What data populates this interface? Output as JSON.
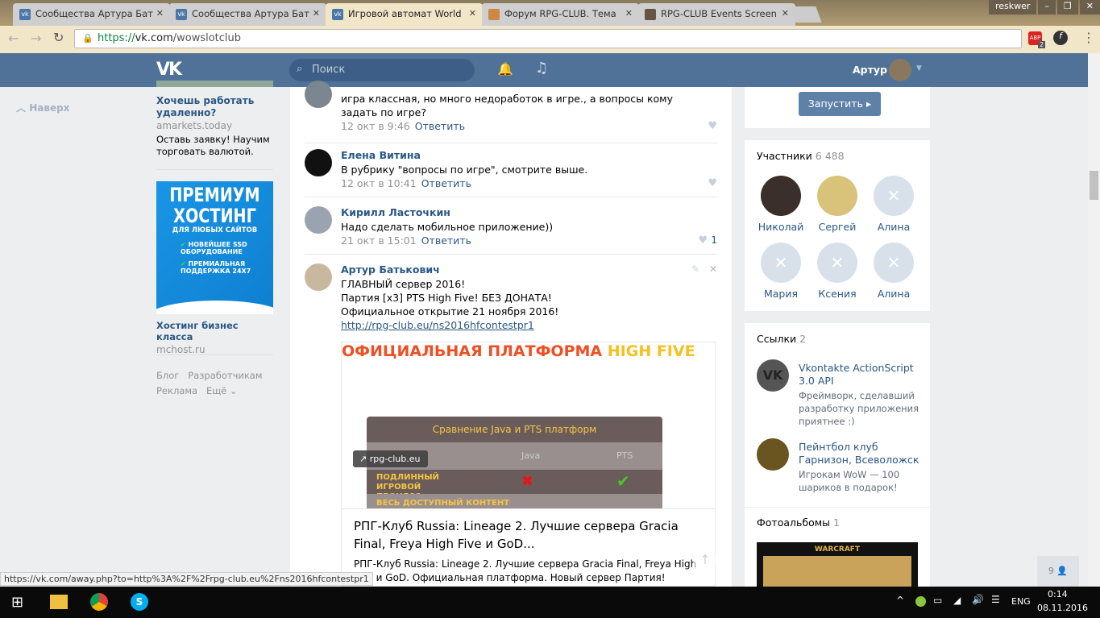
{
  "browser": {
    "tabs": [
      {
        "title": "Сообщества Артура Бат"
      },
      {
        "title": "Сообщества Артура Бат"
      },
      {
        "title": "Игровой автомат World"
      },
      {
        "title": "Форум RPG-CLUB. Тема"
      },
      {
        "title": "RPG-CLUB Events Screen"
      }
    ],
    "user": "reskwer",
    "url_scheme": "https://",
    "url_host": "vk.com",
    "url_path": "/wowslotclub",
    "abp_count": "2",
    "status_url": "https://vk.com/away.php?to=http%3A%2F%2Frpg-club.eu%2Fns2016hfcontestpr1"
  },
  "header": {
    "search_placeholder": "Поиск",
    "user_name": "Артур"
  },
  "left": {
    "to_top": "Наверх"
  },
  "ads": [
    {
      "title": "Хочешь работать удаленно?",
      "domain": "amarkets.today",
      "text": "Оставь заявку! Научим торговать валютой."
    },
    {
      "banner_l1": "ПРЕМИУМ",
      "banner_l2": "ХОСТИНГ",
      "banner_l3": "ДЛЯ ЛЮБЫХ САЙТОВ",
      "banner_f1": "НОВЕЙШЕЕ SSD ОБОРУДОВАНИЕ",
      "banner_f2": "ПРЕМИАЛЬНАЯ ПОДДЕРЖКА 24X7",
      "title": "Хостинг бизнес класса",
      "domain": "mchost.ru"
    }
  ],
  "footer_links": [
    "Блог",
    "Разработчикам",
    "Реклама",
    "Ещё"
  ],
  "comments": [
    {
      "text": "игра классная, но много недоработок в игре., а вопросы кому задать по игре?",
      "time": "12 окт в 9:46",
      "reply": "Ответить"
    },
    {
      "name": "Елена Витина",
      "text": "В рубрику \"вопросы по игре\", смотрите выше.",
      "time": "12 окт в 10:41",
      "reply": "Ответить"
    },
    {
      "name": "Кирилл Ласточкин",
      "text": "Надо сделать мобильное приложение))",
      "time": "21 окт в 15:01",
      "reply": "Ответить",
      "likes": "1"
    },
    {
      "name": "Артур Батькович",
      "line1": "ГЛАВНЫЙ сервер 2016!",
      "line2": "Партия [x3] PTS High Five! БЕЗ ДОНАТА!",
      "line3": "Официальное открытие 21 ноября 2016!",
      "link": "http://rpg-club.eu/ns2016hfcontestpr1"
    }
  ],
  "attachment": {
    "banner_red": "ОФИЦИАЛЬНАЯ ПЛАТФОРМА ",
    "banner_yellow": "HIGH FIVE",
    "table_title": "Сравнение Java и PTS платформ",
    "col1": "Java",
    "col2": "PTS",
    "row1": "ПОДЛИННЫЙ ИГРОВОЙ ПРОЦЕСС",
    "row2": "ВЕСЬ ДОСТУПНЫЙ КОНТЕНТ",
    "domain": "rpg-club.eu",
    "title": "РПГ-Клуб Russia: Lineage 2. Лучшие сервера Gracia Final, Freya High Five и GoD...",
    "desc": "РПГ-Клуб Russia: Lineage 2. Лучшие сервера Gracia Final, Freya High Five и GoD. Официальная платформа. Новый сервер Партия!"
  },
  "app_button": "Запустить ▸",
  "members": {
    "label": "Участники",
    "count": "6 488",
    "list": [
      "Николай",
      "Сергей",
      "Алина",
      "Мария",
      "Ксения",
      "Алина"
    ]
  },
  "links": {
    "label": "Ссылки",
    "count": "2",
    "list": [
      {
        "title": "Vkontakte ActionScript 3.0 API",
        "desc": "Фреймворк, сделавший разработку приложения приятнее :)"
      },
      {
        "title": "Пейнтбол клуб Гарнизон, Всеволожск",
        "desc": "Игрокам WoW — 100 шариков в подарок!"
      }
    ]
  },
  "albums": {
    "label": "Фотоальбомы",
    "count": "1",
    "thumb_text": "WARCRAFT"
  },
  "online_count": "9",
  "taskbar": {
    "lang": "ENG",
    "time": "0:14",
    "date": "08.11.2016"
  }
}
